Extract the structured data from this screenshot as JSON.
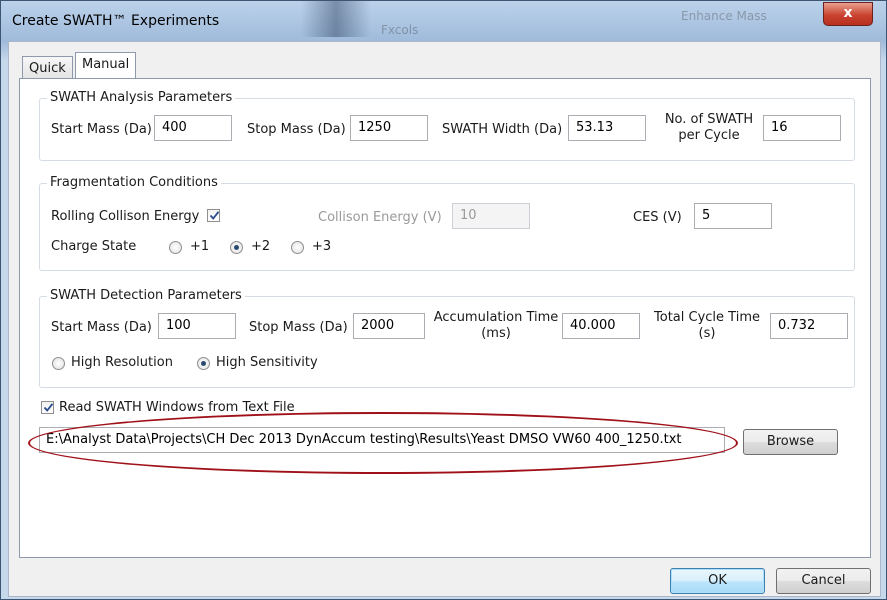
{
  "window": {
    "title": "Create SWATH™ Experiments",
    "close_label": "x"
  },
  "background": {
    "blur_a": "Fxcols",
    "blur_b": "Enhance Mass"
  },
  "tabs": [
    {
      "label": "Quick"
    },
    {
      "label": "Manual"
    }
  ],
  "analysis": {
    "legend": "SWATH Analysis Parameters",
    "start_mass_label": "Start Mass (Da)",
    "start_mass": "400",
    "stop_mass_label": "Stop Mass (Da)",
    "stop_mass": "1250",
    "swath_width_label": "SWATH Width (Da)",
    "swath_width": "53.13",
    "per_cycle_label_1": "No. of SWATH",
    "per_cycle_label_2": "per Cycle",
    "per_cycle": "16"
  },
  "fragmentation": {
    "legend": "Fragmentation Conditions",
    "rolling_label": "Rolling Collison Energy",
    "rolling_checked": true,
    "ce_label": "Collison Energy (V)",
    "ce": "10",
    "ces_label": "CES (V)",
    "ces": "5",
    "charge_label": "Charge State",
    "charges": [
      {
        "label": "+1",
        "selected": false
      },
      {
        "label": "+2",
        "selected": true
      },
      {
        "label": "+3",
        "selected": false
      }
    ]
  },
  "detection": {
    "legend": "SWATH Detection Parameters",
    "start_mass_label": "Start Mass (Da)",
    "start_mass": "100",
    "stop_mass_label": "Stop Mass (Da)",
    "stop_mass": "2000",
    "accum_label_1": "Accumulation Time",
    "accum_label_2": "(ms)",
    "accum": "40.000",
    "cycle_label_1": "Total Cycle Time",
    "cycle_label_2": "(s)",
    "cycle": "0.732",
    "modes": [
      {
        "label": "High Resolution",
        "selected": false
      },
      {
        "label": "High Sensitivity",
        "selected": true
      }
    ]
  },
  "file": {
    "read_label": "Read SWATH Windows from Text File",
    "read_checked": true,
    "path": "E:\\Analyst Data\\Projects\\CH Dec 2013 DynAccum testing\\Results\\Yeast DMSO VW60 400_1250.txt",
    "browse_label": "Browse"
  },
  "footer": {
    "ok_label": "OK",
    "cancel_label": "Cancel"
  },
  "colors": {
    "annotation_ellipse": "#a01018",
    "close_button": "#c9432f"
  }
}
